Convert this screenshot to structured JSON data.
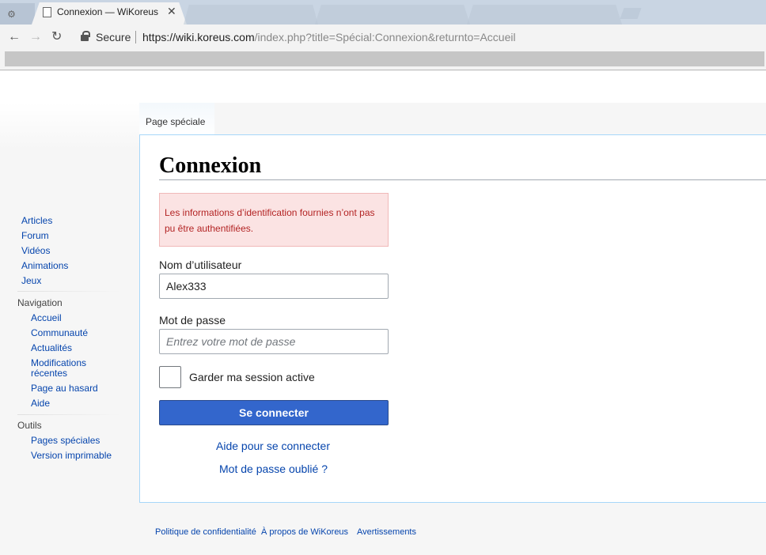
{
  "browser": {
    "active_tab_title": "Connexion — WiKoreus",
    "secure_label": "Secure",
    "url_host": "https://wiki.koreus.com",
    "url_path": "/index.php?title=Spécial:Connexion&returnto=Accueil"
  },
  "sidebar": {
    "main_links": [
      "Articles",
      "Forum",
      "Vidéos",
      "Animations",
      "Jeux"
    ],
    "navigation_heading": "Navigation",
    "navigation_links": [
      "Accueil",
      "Communauté",
      "Actualités",
      "Modifications récentes",
      "Page au hasard",
      "Aide"
    ],
    "tools_heading": "Outils",
    "tools_links": [
      "Pages spéciales",
      "Version imprimable"
    ]
  },
  "content": {
    "tab_label": "Page spéciale",
    "heading": "Connexion",
    "error_message": "Les informations d’identification fournies n’ont pas pu être authentifiées.",
    "username_label": "Nom d’utilisateur",
    "username_value": "Alex333",
    "password_label": "Mot de passe",
    "password_placeholder": "Entrez votre mot de passe",
    "remember_label": "Garder ma session active",
    "submit_label": "Se connecter",
    "help_link": "Aide pour se connecter",
    "forgot_link": "Mot de passe oublié ?"
  },
  "footer": {
    "links": [
      "Politique de confidentialité",
      "À propos de WiKoreus",
      "Avertissements"
    ]
  }
}
